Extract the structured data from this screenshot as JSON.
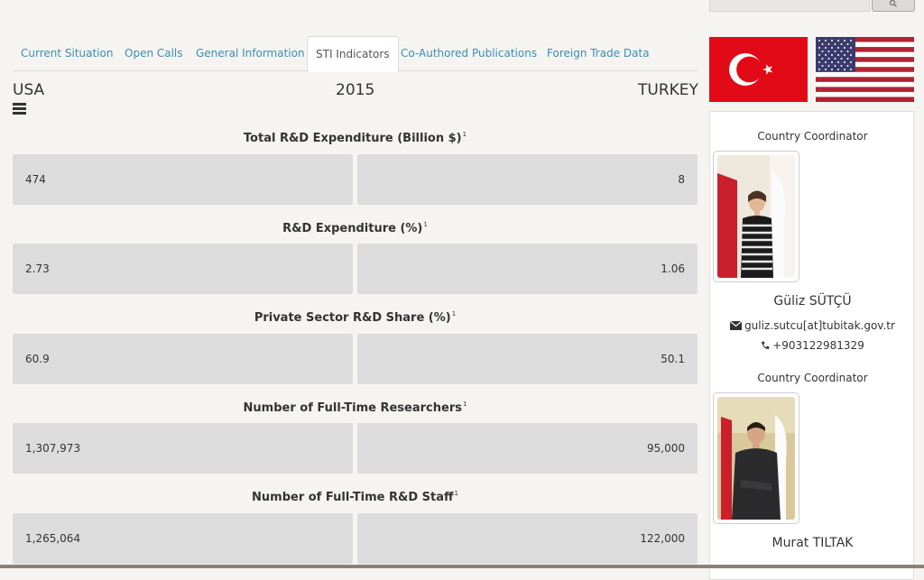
{
  "tabs": [
    {
      "label": "Current Situation"
    },
    {
      "label": "Open Calls"
    },
    {
      "label": "General Information"
    },
    {
      "label": "STI Indicators"
    },
    {
      "label": "Co-Authored Publications"
    },
    {
      "label": "Foreign Trade Data"
    }
  ],
  "active_tab": "STI Indicators",
  "header": {
    "left_country": "USA",
    "year": "2015",
    "right_country": "TURKEY"
  },
  "indicators": [
    {
      "title": "Total R&D Expenditure (Billion $)",
      "note": "1",
      "usa": "474",
      "turkey": "8"
    },
    {
      "title": "R&D Expenditure (%)",
      "note": "1",
      "usa": "2.73",
      "turkey": "1.06"
    },
    {
      "title": "Private Sector R&D Share (%)",
      "note": "1",
      "usa": "60.9",
      "turkey": "50.1"
    },
    {
      "title": "Number of Full-Time Researchers",
      "note": "1",
      "usa": "1,307,973",
      "turkey": "95,000"
    },
    {
      "title": "Number of Full-Time R&D Staff",
      "note": "1",
      "usa": "1,265,064",
      "turkey": "122,000"
    }
  ],
  "coordinators": [
    {
      "label": "Country Coordinator",
      "name": "Güliz SÜTÇÜ",
      "email": "guliz.sutcu[at]tubitak.gov.tr",
      "phone": "+903122981329"
    },
    {
      "label": "Country Coordinator",
      "name": "Murat TILTAK"
    }
  ],
  "icons": {
    "search": "search-icon",
    "menu": "hamburger-icon",
    "email": "envelope-icon",
    "phone": "phone-icon"
  },
  "colors": {
    "tab_link": "#3a8fb1",
    "value_box": "#dcdcdc",
    "turkey_red": "#e30a17",
    "us_red": "#b22234",
    "us_blue": "#3c3b6e"
  }
}
